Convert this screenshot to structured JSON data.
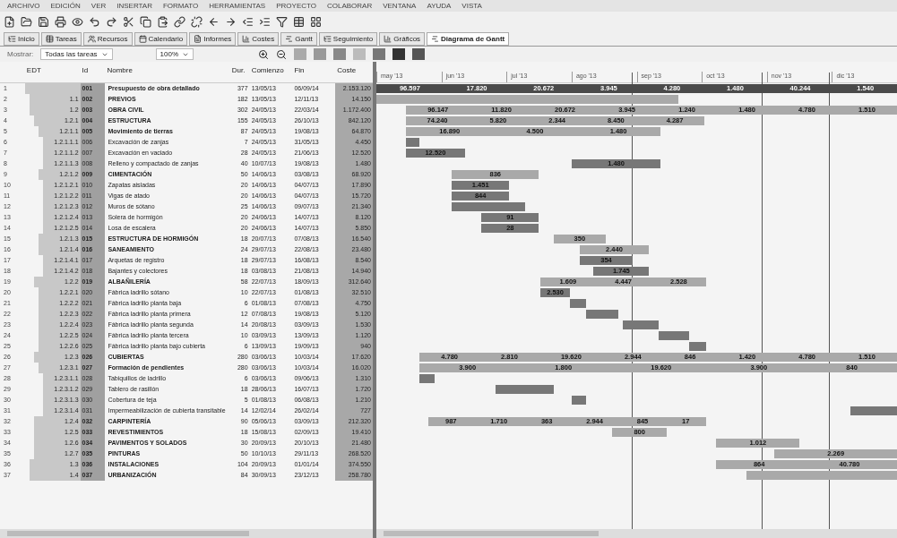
{
  "menu": [
    "ARCHIVO",
    "EDICIÓN",
    "VER",
    "INSERTAR",
    "FORMATO",
    "HERRAMIENTAS",
    "PROYECTO",
    "COLABORAR",
    "VENTANA",
    "AYUDA",
    "VISTA"
  ],
  "tabs": [
    {
      "label": "Inicio",
      "selected": false
    },
    {
      "label": "Tareas",
      "selected": false
    },
    {
      "label": "Recursos",
      "selected": false
    },
    {
      "label": "Calendario",
      "selected": false
    },
    {
      "label": "Informes",
      "selected": false
    },
    {
      "label": "Costes",
      "selected": false
    },
    {
      "label": "Gantt",
      "selected": false
    },
    {
      "label": "Seguimiento",
      "selected": false
    },
    {
      "label": "Gráficos",
      "selected": false
    },
    {
      "label": "Diagrama de Gantt",
      "selected": true
    }
  ],
  "filter": {
    "label": "Mostrar:",
    "value": "Todas las tareas",
    "zoom": "100%"
  },
  "columns": [
    "EDT",
    "Id",
    "Nombre",
    "Dur.",
    "Comienzo",
    "Fin",
    "Coste"
  ],
  "timeline": [
    "may '13",
    "jun '13",
    "jul '13",
    "ago '13",
    "sep '13",
    "oct '13",
    "nov '13",
    "dic '13"
  ],
  "rows": [
    {
      "num": "1",
      "id": "001",
      "name": "Presupuesto de obra detallado",
      "dur": "377",
      "start": "13/05/13",
      "end": "06/09/14",
      "cost": "2.153.120",
      "summary": true,
      "bar_labels": [
        "96.597",
        "17.820",
        "20.672",
        "3.945",
        "4.280",
        "1.480",
        "40.244",
        "1.540"
      ],
      "children": [
        {
          "num": "2",
          "wbs": "1.1",
          "id": "002",
          "name": "PREVIOS",
          "dur": "182",
          "start": "13/05/13",
          "end": "12/11/13",
          "cost": "14.150",
          "summary": true
        },
        {
          "num": "3",
          "wbs": "1.2",
          "id": "003",
          "name": "OBRA CIVIL",
          "dur": "302",
          "start": "24/05/13",
          "end": "22/03/14",
          "cost": "1.172.400",
          "summary": true,
          "bar_labels": [
            "96.147",
            "11.820",
            "20.672",
            "3.945",
            "1.240",
            "1.480",
            "4.780",
            "1.510"
          ],
          "children": [
            {
              "num": "4",
              "wbs": "1.2.1",
              "id": "004",
              "name": "ESTRUCTURA",
              "dur": "155",
              "start": "24/05/13",
              "end": "26/10/13",
              "cost": "842.120",
              "summary": true,
              "bar_labels": [
                "74.240",
                "5.820",
                "2.344",
                "8.450",
                "4.287"
              ],
              "children": [
                {
                  "num": "5",
                  "wbs": "1.2.1.1",
                  "id": "005",
                  "name": "Movimiento de tierras",
                  "dur": "87",
                  "start": "24/05/13",
                  "end": "19/08/13",
                  "cost": "64.870",
                  "summary": true,
                  "bar_labels": [
                    "16.890",
                    "4.500",
                    "1.480"
                  ],
                  "children": [
                    {
                      "num": "6",
                      "wbs": "1.2.1.1.1",
                      "id": "006",
                      "name": "Excavación de zanjas",
                      "dur": "7",
                      "start": "24/05/13",
                      "end": "31/05/13",
                      "cost": "4.450",
                      "summary": false
                    },
                    {
                      "num": "7",
                      "wbs": "1.2.1.1.2",
                      "id": "007",
                      "name": "Excavación en vaciado",
                      "dur": "28",
                      "start": "24/05/13",
                      "end": "21/06/13",
                      "cost": "12.520",
                      "summary": false,
                      "bar_labels": [
                        "12.520"
                      ]
                    },
                    {
                      "num": "8",
                      "wbs": "1.2.1.1.3",
                      "id": "008",
                      "name": "Relleno y compactado de zanjas",
                      "dur": "40",
                      "start": "10/07/13",
                      "end": "19/08/13",
                      "cost": "1.480",
                      "summary": false,
                      "bar_labels": [
                        "1.480"
                      ]
                    }
                  ]
                },
                {
                  "num": "9",
                  "wbs": "1.2.1.2",
                  "id": "009",
                  "name": "CIMENTACIÓN",
                  "dur": "50",
                  "start": "14/06/13",
                  "end": "03/08/13",
                  "cost": "68.920",
                  "summary": true,
                  "bar_labels": [
                    "836"
                  ],
                  "children": [
                    {
                      "num": "10",
                      "wbs": "1.2.1.2.1",
                      "id": "010",
                      "name": "Zapatas aisladas",
                      "dur": "20",
                      "start": "14/06/13",
                      "end": "04/07/13",
                      "cost": "17.890",
                      "summary": false,
                      "bar_labels": [
                        "1.451"
                      ]
                    },
                    {
                      "num": "11",
                      "wbs": "1.2.1.2.2",
                      "id": "011",
                      "name": "Vigas de atado",
                      "dur": "20",
                      "start": "14/06/13",
                      "end": "04/07/13",
                      "cost": "15.720",
                      "summary": false,
                      "bar_labels": [
                        "844"
                      ]
                    },
                    {
                      "num": "12",
                      "wbs": "1.2.1.2.3",
                      "id": "012",
                      "name": "Muros de sótano",
                      "dur": "25",
                      "start": "14/06/13",
                      "end": "09/07/13",
                      "cost": "21.340",
                      "summary": false
                    },
                    {
                      "num": "13",
                      "wbs": "1.2.1.2.4",
                      "id": "013",
                      "name": "Solera de hormigón",
                      "dur": "20",
                      "start": "24/06/13",
                      "end": "14/07/13",
                      "cost": "8.120",
                      "summary": false,
                      "bar_labels": [
                        "91"
                      ]
                    },
                    {
                      "num": "14",
                      "wbs": "1.2.1.2.5",
                      "id": "014",
                      "name": "Losa de escalera",
                      "dur": "20",
                      "start": "24/06/13",
                      "end": "14/07/13",
                      "cost": "5.850",
                      "summary": false,
                      "bar_labels": [
                        "28"
                      ]
                    }
                  ]
                },
                {
                  "num": "15",
                  "wbs": "1.2.1.3",
                  "id": "015",
                  "name": "ESTRUCTURA DE HORMIGÓN",
                  "dur": "18",
                  "start": "20/07/13",
                  "end": "07/08/13",
                  "cost": "16.540",
                  "summary": true,
                  "bar_labels": [
                    "350"
                  ]
                },
                {
                  "num": "16",
                  "wbs": "1.2.1.4",
                  "id": "016",
                  "name": "SANEAMIENTO",
                  "dur": "24",
                  "start": "29/07/13",
                  "end": "22/08/13",
                  "cost": "23.480",
                  "summary": true,
                  "bar_labels": [
                    "2.440"
                  ],
                  "children": [
                    {
                      "num": "17",
                      "wbs": "1.2.1.4.1",
                      "id": "017",
                      "name": "Arquetas de registro",
                      "dur": "18",
                      "start": "29/07/13",
                      "end": "16/08/13",
                      "cost": "8.540",
                      "summary": false,
                      "bar_labels": [
                        "354"
                      ]
                    },
                    {
                      "num": "18",
                      "wbs": "1.2.1.4.2",
                      "id": "018",
                      "name": "Bajantes y colectores",
                      "dur": "18",
                      "start": "03/08/13",
                      "end": "21/08/13",
                      "cost": "14.940",
                      "summary": false,
                      "bar_labels": [
                        "1.745"
                      ]
                    }
                  ]
                }
              ]
            },
            {
              "num": "19",
              "wbs": "1.2.2",
              "id": "019",
              "name": "ALBAÑILERÍA",
              "dur": "58",
              "start": "22/07/13",
              "end": "18/09/13",
              "cost": "312.640",
              "summary": true,
              "bar_labels": [
                "1.609",
                "4.447",
                "2.528"
              ],
              "children": [
                {
                  "num": "20",
                  "wbs": "1.2.2.1",
                  "id": "020",
                  "name": "Fábrica ladrillo sótano",
                  "dur": "10",
                  "start": "22/07/13",
                  "end": "01/08/13",
                  "cost": "32.510",
                  "summary": false,
                  "bar_labels": [
                    "2.530"
                  ]
                },
                {
                  "num": "21",
                  "wbs": "1.2.2.2",
                  "id": "021",
                  "name": "Fábrica ladrillo planta baja",
                  "dur": "6",
                  "start": "01/08/13",
                  "end": "07/08/13",
                  "cost": "4.750",
                  "summary": false
                },
                {
                  "num": "22",
                  "wbs": "1.2.2.3",
                  "id": "022",
                  "name": "Fábrica ladrillo planta primera",
                  "dur": "12",
                  "start": "07/08/13",
                  "end": "19/08/13",
                  "cost": "5.120",
                  "summary": false
                },
                {
                  "num": "23",
                  "wbs": "1.2.2.4",
                  "id": "023",
                  "name": "Fábrica ladrillo planta segunda",
                  "dur": "14",
                  "start": "20/08/13",
                  "end": "03/09/13",
                  "cost": "1.530",
                  "summary": false
                },
                {
                  "num": "24",
                  "wbs": "1.2.2.5",
                  "id": "024",
                  "name": "Fábrica ladrillo planta tercera",
                  "dur": "10",
                  "start": "03/09/13",
                  "end": "13/09/13",
                  "cost": "1.120",
                  "summary": false
                },
                {
                  "num": "25",
                  "wbs": "1.2.2.6",
                  "id": "025",
                  "name": "Fábrica ladrillo planta bajo cubierta",
                  "dur": "6",
                  "start": "13/09/13",
                  "end": "19/09/13",
                  "cost": "940",
                  "summary": false
                }
              ]
            },
            {
              "num": "26",
              "wbs": "1.2.3",
              "id": "026",
              "name": "CUBIERTAS",
              "dur": "280",
              "start": "03/06/13",
              "end": "10/03/14",
              "cost": "17.620",
              "summary": true,
              "bar_labels": [
                "4.780",
                "2.810",
                "19.620",
                "2.944",
                "846",
                "1.420",
                "4.780",
                "1.510"
              ],
              "children": [
                {
                  "num": "27",
                  "wbs": "1.2.3.1",
                  "id": "027",
                  "name": "Formación de pendientes",
                  "dur": "280",
                  "start": "03/06/13",
                  "end": "10/03/14",
                  "cost": "16.020",
                  "summary": true,
                  "bar_labels": [
                    "3.900",
                    "1.800",
                    "19.620",
                    "3.900",
                    "840"
                  ],
                  "children": [
                    {
                      "num": "28",
                      "wbs": "1.2.3.1.1",
                      "id": "028",
                      "name": "Tabiquillos de ladrillo",
                      "dur": "6",
                      "start": "03/06/13",
                      "end": "09/06/13",
                      "cost": "1.310",
                      "summary": false
                    },
                    {
                      "num": "29",
                      "wbs": "1.2.3.1.2",
                      "id": "029",
                      "name": "Tablero de rasillón",
                      "dur": "18",
                      "start": "28/06/13",
                      "end": "16/07/13",
                      "cost": "1.720",
                      "summary": false
                    },
                    {
                      "num": "30",
                      "wbs": "1.2.3.1.3",
                      "id": "030",
                      "name": "Cobertura de teja",
                      "dur": "5",
                      "start": "01/08/13",
                      "end": "06/08/13",
                      "cost": "1.210",
                      "summary": false
                    },
                    {
                      "num": "31",
                      "wbs": "1.2.3.1.4",
                      "id": "031",
                      "name": "Impermeabilización de cubierta transitable",
                      "dur": "14",
                      "start": "12/02/14",
                      "end": "26/02/14",
                      "cost": "727",
                      "summary": false
                    }
                  ]
                }
              ]
            },
            {
              "num": "32",
              "wbs": "1.2.4",
              "id": "032",
              "name": "CARPINTERÍA",
              "dur": "90",
              "start": "05/06/13",
              "end": "03/09/13",
              "cost": "212.320",
              "summary": true,
              "bar_labels": [
                "987",
                "1.710",
                "363",
                "2.944",
                "845",
                "17"
              ]
            },
            {
              "num": "33",
              "wbs": "1.2.5",
              "id": "033",
              "name": "REVESTIMIENTOS",
              "dur": "18",
              "start": "15/08/13",
              "end": "02/09/13",
              "cost": "19.410",
              "summary": true,
              "bar_labels": [
                "800"
              ]
            },
            {
              "num": "34",
              "wbs": "1.2.6",
              "id": "034",
              "name": "PAVIMENTOS Y SOLADOS",
              "dur": "30",
              "start": "20/09/13",
              "end": "20/10/13",
              "cost": "21.480",
              "summary": true,
              "bar_labels": [
                "1.012"
              ]
            },
            {
              "num": "35",
              "wbs": "1.2.7",
              "id": "035",
              "name": "PINTURAS",
              "dur": "50",
              "start": "10/10/13",
              "end": "29/11/13",
              "cost": "268.520",
              "summary": true,
              "bar_labels": [
                "2.269"
              ]
            }
          ]
        },
        {
          "num": "36",
          "wbs": "1.3",
          "id": "036",
          "name": "INSTALACIONES",
          "dur": "104",
          "start": "20/09/13",
          "end": "01/01/14",
          "cost": "374.550",
          "summary": true,
          "bar_labels": [
            "864",
            "40.780"
          ]
        },
        {
          "num": "37",
          "wbs": "1.4",
          "id": "037",
          "name": "URBANIZACIÓN",
          "dur": "84",
          "start": "30/09/13",
          "end": "23/12/13",
          "cost": "258.780",
          "summary": true
        }
      ]
    }
  ]
}
